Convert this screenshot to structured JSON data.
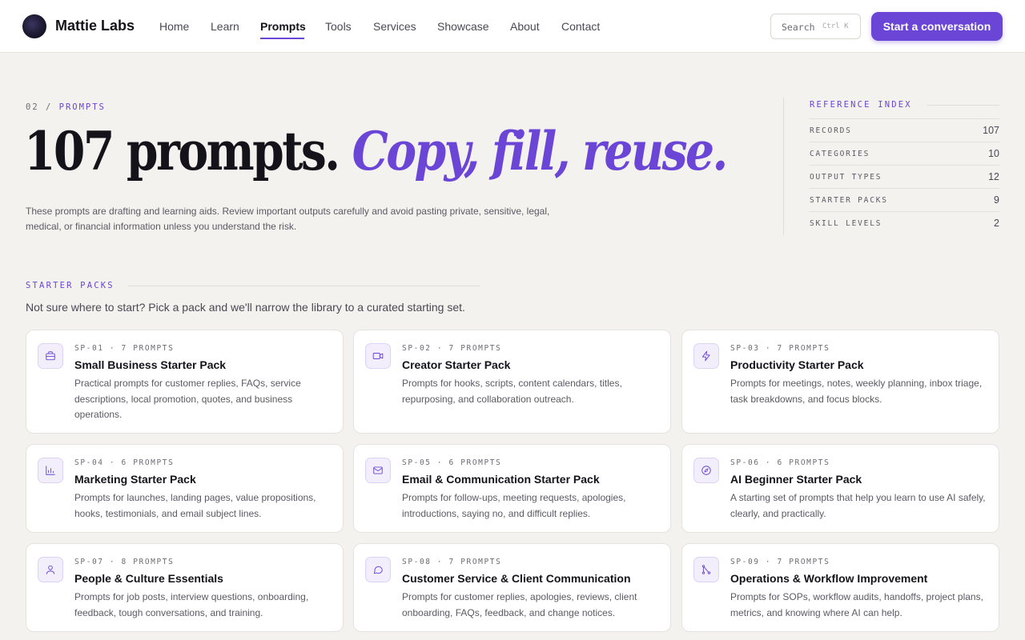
{
  "nav": {
    "brand": "Mattie Labs",
    "links": [
      {
        "label": "Home",
        "active": false
      },
      {
        "label": "Learn",
        "active": false
      },
      {
        "label": "Prompts",
        "active": true
      },
      {
        "label": "Tools",
        "active": false
      },
      {
        "label": "Services",
        "active": false
      },
      {
        "label": "Showcase",
        "active": false
      },
      {
        "label": "About",
        "active": false
      },
      {
        "label": "Contact",
        "active": false
      }
    ],
    "search_label": "Search",
    "search_shortcut": "Ctrl K",
    "cta_label": "Start a conversation"
  },
  "hero": {
    "eyebrow_num": "02 /",
    "eyebrow_label": "PROMPTS",
    "title_plain": "107 prompts.",
    "title_accent": "Copy, fill, reuse.",
    "description": "These prompts are drafting and learning aids. Review important outputs carefully and avoid pasting private, sensitive, legal, medical, or financial information unless you understand the risk."
  },
  "reference_index": {
    "title": "REFERENCE INDEX",
    "rows": [
      {
        "key": "RECORDS",
        "value": "107"
      },
      {
        "key": "CATEGORIES",
        "value": "10"
      },
      {
        "key": "OUTPUT TYPES",
        "value": "12"
      },
      {
        "key": "STARTER PACKS",
        "value": "9"
      },
      {
        "key": "SKILL LEVELS",
        "value": "2"
      }
    ]
  },
  "starter_packs": {
    "label": "STARTER PACKS",
    "subtitle": "Not sure where to start? Pick a pack and we'll narrow the library to a curated starting set.",
    "cards": [
      {
        "meta": "SP-01 · 7 PROMPTS",
        "title": "Small Business Starter Pack",
        "icon": "briefcase-icon",
        "description": "Practical prompts for customer replies, FAQs, service descriptions, local promotion, quotes, and business operations."
      },
      {
        "meta": "SP-02 · 7 PROMPTS",
        "title": "Creator Starter Pack",
        "icon": "video-icon",
        "description": "Prompts for hooks, scripts, content calendars, titles, repurposing, and collaboration outreach."
      },
      {
        "meta": "SP-03 · 7 PROMPTS",
        "title": "Productivity Starter Pack",
        "icon": "lightning-icon",
        "description": "Prompts for meetings, notes, weekly planning, inbox triage, task breakdowns, and focus blocks."
      },
      {
        "meta": "SP-04 · 6 PROMPTS",
        "title": "Marketing Starter Pack",
        "icon": "bar-chart-icon",
        "description": "Prompts for launches, landing pages, value propositions, hooks, testimonials, and email subject lines."
      },
      {
        "meta": "SP-05 · 6 PROMPTS",
        "title": "Email & Communication Starter Pack",
        "icon": "mail-icon",
        "description": "Prompts for follow-ups, meeting requests, apologies, introductions, saying no, and difficult replies."
      },
      {
        "meta": "SP-06 · 6 PROMPTS",
        "title": "AI Beginner Starter Pack",
        "icon": "compass-icon",
        "description": "A starting set of prompts that help you learn to use AI safely, clearly, and practically."
      },
      {
        "meta": "SP-07 · 8 PROMPTS",
        "title": "People & Culture Essentials",
        "icon": "user-icon",
        "description": "Prompts for job posts, interview questions, onboarding, feedback, tough conversations, and training."
      },
      {
        "meta": "SP-08 · 7 PROMPTS",
        "title": "Customer Service & Client Communication",
        "icon": "chat-bubble-icon",
        "description": "Prompts for customer replies, apologies, reviews, client onboarding, FAQs, feedback, and change notices."
      },
      {
        "meta": "SP-09 · 7 PROMPTS",
        "title": "Operations & Workflow Improvement",
        "icon": "workflow-icon",
        "description": "Prompts for SOPs, workflow audits, handoffs, project plans, metrics, and knowing where AI can help."
      }
    ]
  }
}
